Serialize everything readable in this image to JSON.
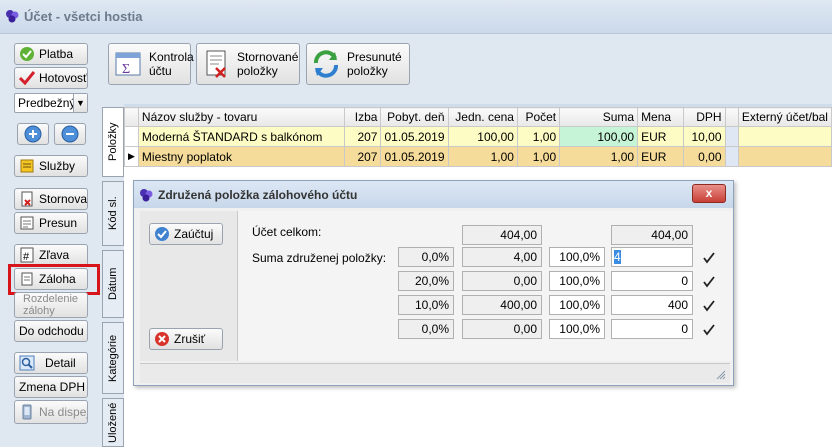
{
  "window": {
    "title": "Účet - všetci hostia"
  },
  "sidebar": {
    "platba": "Platba",
    "hotovost": "Hotovosť",
    "mode_select": "Predbežný",
    "sluzby": "Služby",
    "stornovat": "Stornovať",
    "presun": "Presun",
    "zlava": "Zľava",
    "zaloha": "Záloha",
    "rozdelenie": "Rozdelenie zálohy",
    "do_odchodu": "Do odchodu",
    "detail": "Detail",
    "zmena_dph": "Zmena DPH",
    "na_dispej": "Na dispej"
  },
  "toolbar": {
    "kontrola": [
      "Kontrola",
      "účtu"
    ],
    "stornovane": [
      "Stornované",
      "položky"
    ],
    "presunute": [
      "Presunuté",
      "položky"
    ]
  },
  "tabs": [
    "Položky",
    "Kód sl.",
    "Dátum",
    "Kategórie",
    "Uložené"
  ],
  "grid": {
    "columns": [
      "Názov služby - tovaru",
      "Izba",
      "Pobyt. deň",
      "Jedn. cena",
      "Počet",
      "Suma",
      "Mena",
      "DPH",
      "",
      "Externý účet/bal"
    ],
    "rows": [
      [
        "Moderná ŠTANDARD s balkónom",
        "207",
        "01.05.2019",
        "100,00",
        "1,00",
        "100,00",
        "EUR",
        "10,00",
        "",
        ""
      ],
      [
        "Miestny poplatok",
        "207",
        "01.05.2019",
        "1,00",
        "1,00",
        "1,00",
        "EUR",
        "0,00",
        "",
        ""
      ]
    ]
  },
  "dialog": {
    "title": "Združená položka zálohového účtu",
    "zauctuj": "Zaúčtuj",
    "zrusit": "Zrušiť",
    "close": "x",
    "ucet_label": "Účet celkom:",
    "suma_label": "Suma združenej položky:",
    "ucet_celkom_1": "404,00",
    "ucet_celkom_2": "404,00",
    "rows": [
      {
        "dph": "0,0%",
        "amount": "4,00",
        "pct": "100,0%",
        "value": "4"
      },
      {
        "dph": "20,0%",
        "amount": "0,00",
        "pct": "100,0%",
        "value": "0"
      },
      {
        "dph": "10,0%",
        "amount": "400,00",
        "pct": "100,0%",
        "value": "400"
      },
      {
        "dph": "0,0%",
        "amount": "0,00",
        "pct": "100,0%",
        "value": "0"
      }
    ]
  },
  "colors": {
    "highlight": "#d8141b",
    "row_yellow": "#fdfcc4",
    "row_orange": "#f5dc9a",
    "suma_green": "#c5f4d6"
  }
}
